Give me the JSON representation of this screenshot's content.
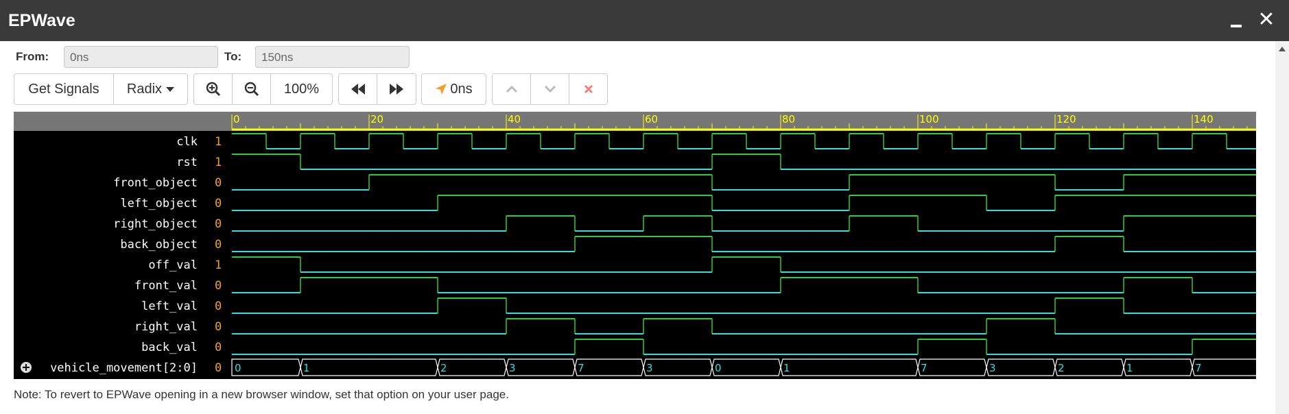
{
  "window": {
    "title": "EPWave",
    "minimize_icon": "minimize-icon",
    "close_glyph": "✕"
  },
  "range": {
    "from_label": "From:",
    "from_placeholder": "0ns",
    "to_label": "To:",
    "to_placeholder": "150ns"
  },
  "toolbar": {
    "get_signals": "Get Signals",
    "radix": "Radix",
    "zoom_level": "100%",
    "cursor_time": "0ns"
  },
  "timeline": {
    "ticks": [
      "0",
      "20",
      "40",
      "60",
      "80",
      "100",
      "120",
      "140"
    ]
  },
  "signals": [
    {
      "name": "clk",
      "value": "1"
    },
    {
      "name": "rst",
      "value": "1"
    },
    {
      "name": "front_object",
      "value": "0"
    },
    {
      "name": "left_object",
      "value": "0"
    },
    {
      "name": "right_object",
      "value": "0"
    },
    {
      "name": "back_object",
      "value": "0"
    },
    {
      "name": "off_val",
      "value": "1"
    },
    {
      "name": "front_val",
      "value": "0"
    },
    {
      "name": "left_val",
      "value": "0"
    },
    {
      "name": "right_val",
      "value": "0"
    },
    {
      "name": "back_val",
      "value": "0"
    },
    {
      "name": "vehicle_movement[2:0]",
      "value": "0"
    }
  ],
  "waveforms": {
    "time_end": 150,
    "clk_period": 10,
    "clk_first_high": 0,
    "digital": {
      "rst": [
        [
          0,
          1
        ],
        [
          10,
          0
        ],
        [
          70,
          1
        ],
        [
          80,
          0
        ]
      ],
      "front_object": [
        [
          0,
          0
        ],
        [
          20,
          1
        ],
        [
          70,
          0
        ],
        [
          90,
          1
        ],
        [
          120,
          0
        ],
        [
          130,
          1
        ]
      ],
      "left_object": [
        [
          0,
          0
        ],
        [
          30,
          1
        ],
        [
          70,
          0
        ],
        [
          90,
          1
        ],
        [
          110,
          0
        ],
        [
          120,
          1
        ]
      ],
      "right_object": [
        [
          0,
          0
        ],
        [
          40,
          1
        ],
        [
          50,
          0
        ],
        [
          60,
          1
        ],
        [
          70,
          0
        ],
        [
          90,
          1
        ],
        [
          100,
          0
        ],
        [
          130,
          1
        ]
      ],
      "back_object": [
        [
          0,
          0
        ],
        [
          50,
          1
        ],
        [
          70,
          0
        ],
        [
          120,
          1
        ],
        [
          130,
          0
        ]
      ],
      "off_val": [
        [
          0,
          1
        ],
        [
          10,
          0
        ],
        [
          70,
          1
        ],
        [
          80,
          0
        ]
      ],
      "front_val": [
        [
          0,
          0
        ],
        [
          10,
          1
        ],
        [
          30,
          0
        ],
        [
          80,
          1
        ],
        [
          100,
          0
        ],
        [
          130,
          1
        ],
        [
          140,
          0
        ]
      ],
      "left_val": [
        [
          0,
          0
        ],
        [
          30,
          1
        ],
        [
          40,
          0
        ],
        [
          120,
          1
        ],
        [
          130,
          0
        ]
      ],
      "right_val": [
        [
          0,
          0
        ],
        [
          40,
          1
        ],
        [
          50,
          0
        ],
        [
          60,
          1
        ],
        [
          70,
          0
        ],
        [
          110,
          1
        ],
        [
          120,
          0
        ]
      ],
      "back_val": [
        [
          0,
          0
        ],
        [
          50,
          1
        ],
        [
          60,
          0
        ],
        [
          100,
          1
        ],
        [
          110,
          0
        ],
        [
          140,
          1
        ]
      ]
    },
    "bus": {
      "vehicle_movement[2:0]": [
        [
          0,
          "0"
        ],
        [
          10,
          "1"
        ],
        [
          30,
          "2"
        ],
        [
          40,
          "3"
        ],
        [
          50,
          "7"
        ],
        [
          60,
          "3"
        ],
        [
          70,
          "0"
        ],
        [
          80,
          "1"
        ],
        [
          100,
          "7"
        ],
        [
          110,
          "3"
        ],
        [
          120,
          "2"
        ],
        [
          130,
          "1"
        ],
        [
          140,
          "7"
        ]
      ]
    }
  },
  "note": "Note: To revert to EPWave opening in a new browser window, set that option on your user page.",
  "colors": {
    "low": "#33dddd",
    "high": "#33cc33",
    "value_text": "#f0a030",
    "name_text": "#ffffff",
    "ruler_bg": "#777777",
    "ruler_tick": "#ffff00",
    "bus_line": "#ffffff",
    "bus_text": "#33dddd"
  }
}
